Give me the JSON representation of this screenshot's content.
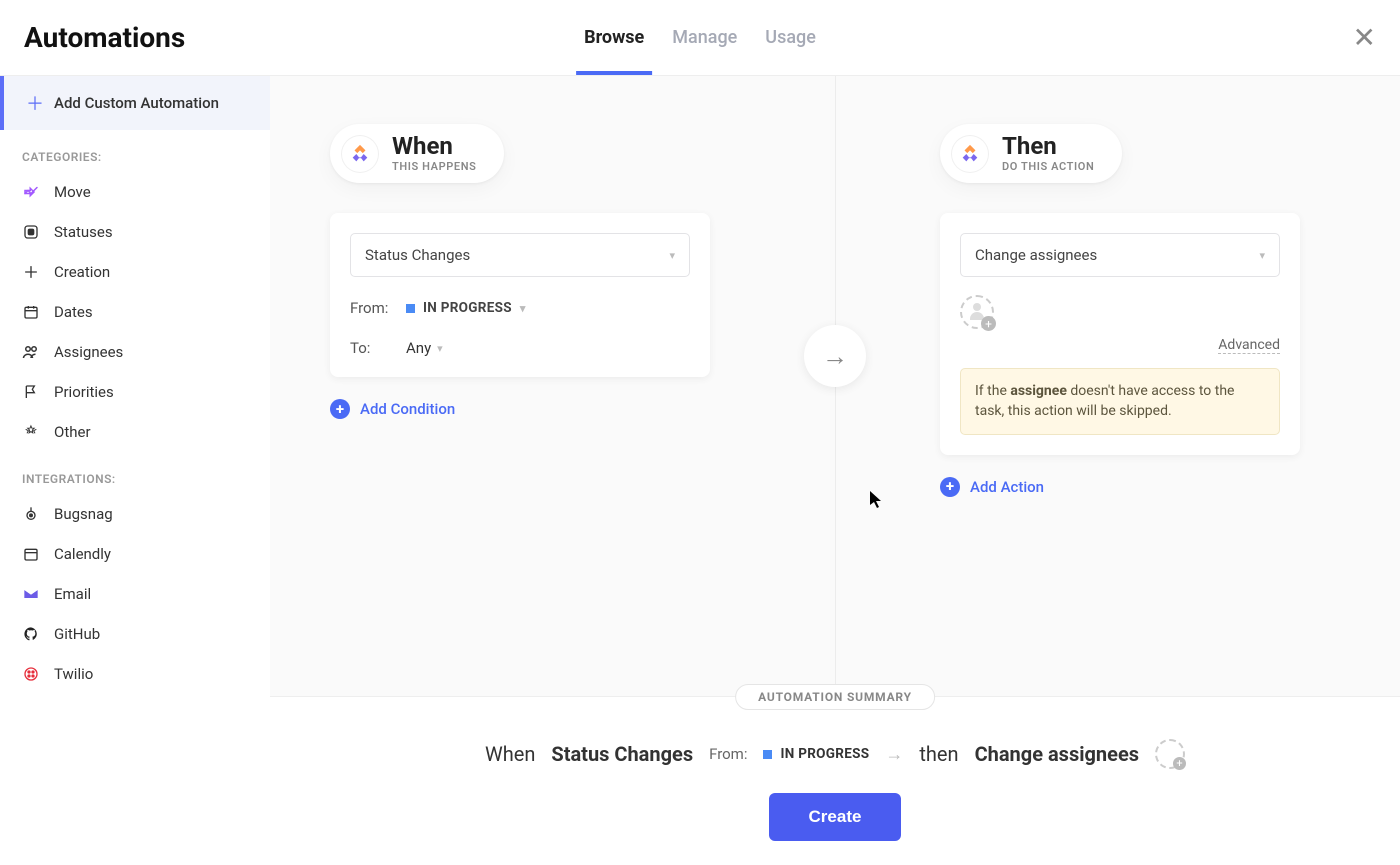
{
  "header": {
    "title": "Automations",
    "tabs": [
      "Browse",
      "Manage",
      "Usage"
    ],
    "active_tab": "Browse"
  },
  "sidebar": {
    "add_custom_label": "Add Custom Automation",
    "categories_label": "CATEGORIES:",
    "categories": [
      {
        "icon": "move-icon",
        "label": "Move"
      },
      {
        "icon": "statuses-icon",
        "label": "Statuses"
      },
      {
        "icon": "creation-icon",
        "label": "Creation"
      },
      {
        "icon": "dates-icon",
        "label": "Dates"
      },
      {
        "icon": "assignees-icon",
        "label": "Assignees"
      },
      {
        "icon": "priorities-icon",
        "label": "Priorities"
      },
      {
        "icon": "other-icon",
        "label": "Other"
      }
    ],
    "integrations_label": "INTEGRATIONS:",
    "integrations": [
      {
        "icon": "bugsnag-icon",
        "label": "Bugsnag"
      },
      {
        "icon": "calendly-icon",
        "label": "Calendly"
      },
      {
        "icon": "email-icon",
        "label": "Email"
      },
      {
        "icon": "github-icon",
        "label": "GitHub"
      },
      {
        "icon": "twilio-icon",
        "label": "Twilio"
      }
    ]
  },
  "when": {
    "title": "When",
    "subtitle": "THIS HAPPENS",
    "trigger": "Status Changes",
    "from_label": "From:",
    "from_value": "IN PROGRESS",
    "from_color": "#4a8bf5",
    "to_label": "To:",
    "to_value": "Any",
    "add_condition": "Add Condition"
  },
  "then": {
    "title": "Then",
    "subtitle": "DO THIS ACTION",
    "action": "Change assignees",
    "advanced_label": "Advanced",
    "info_pre": "If the ",
    "info_bold": "assignee",
    "info_post": " doesn't have access to the task, this action will be skipped.",
    "add_action": "Add Action"
  },
  "summary": {
    "badge": "AUTOMATION SUMMARY",
    "when_word": "When",
    "trigger": "Status Changes",
    "from_label": "From:",
    "from_value": "IN PROGRESS",
    "then_word": "then",
    "action": "Change assignees",
    "create_button": "Create"
  },
  "colors": {
    "primary": "#4a5cf0",
    "link": "#4a6af5"
  }
}
